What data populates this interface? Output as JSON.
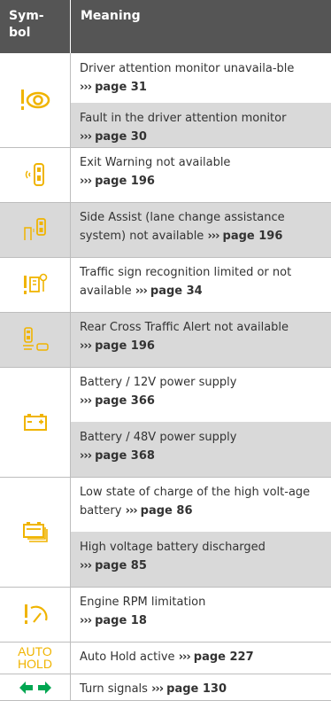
{
  "header": {
    "symbol": "Sym-\nbol",
    "meaning": "Meaning"
  },
  "rows": [
    {
      "text": "Driver attention monitor unavaila-ble",
      "page_label": "page 31",
      "icon": "driver-attention-icon"
    },
    {
      "text": "Fault in the driver attention monitor",
      "page_label": "page 30"
    },
    {
      "text": "Exit Warning not available",
      "page_label": "page 196",
      "icon": "exit-warning-icon"
    },
    {
      "text": "Side Assist (lane change assistance system) not available",
      "page_label": "page 196",
      "icon": "side-assist-icon"
    },
    {
      "text": "Traffic sign recognition limited or not available",
      "page_label": "page 34",
      "icon": "traffic-sign-icon"
    },
    {
      "text": "Rear Cross Traffic Alert not available",
      "page_label": "page 196",
      "icon": "rear-cross-traffic-icon"
    },
    {
      "text": "Battery / 12V power supply",
      "page_label": "page 366",
      "icon": "battery-icon"
    },
    {
      "text": "Battery / 48V power supply",
      "page_label": "page 368"
    },
    {
      "text": "Low state of charge of the high volt-age battery",
      "page_label": "page 86",
      "icon": "high-voltage-battery-icon"
    },
    {
      "text": "High voltage battery discharged",
      "page_label": "page 85"
    },
    {
      "text": "Engine RPM limitation",
      "page_label": "page 18",
      "icon": "rpm-limit-icon"
    },
    {
      "text": "Auto Hold active",
      "page_label": "page 227",
      "icon_text": "AUTO\nHOLD"
    },
    {
      "text": "Turn signals",
      "page_label": "page 130",
      "icon": "turn-signals-icon"
    }
  ],
  "colors": {
    "header_bg": "#555555",
    "alt_row_bg": "#d9d9d9",
    "icon_yellow": "#f0b400"
  }
}
